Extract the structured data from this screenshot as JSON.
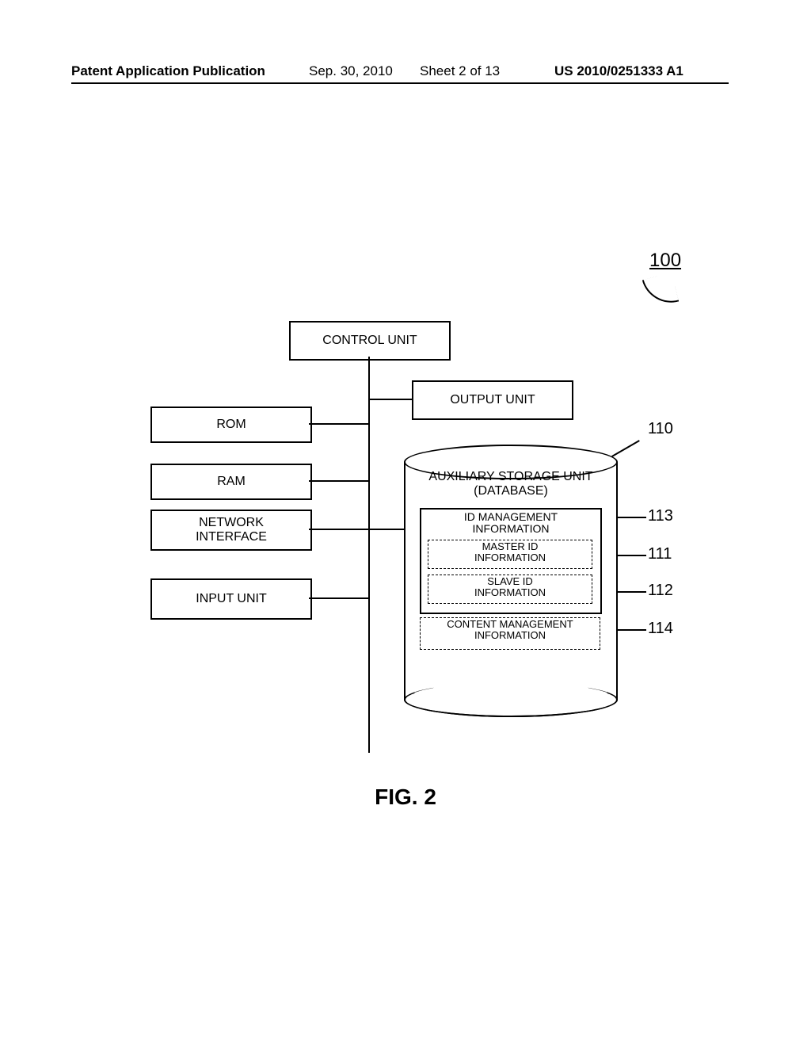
{
  "header": {
    "publication": "Patent Application Publication",
    "date": "Sep. 30, 2010",
    "sheet": "Sheet 2 of 13",
    "patent_no": "US 2010/0251333 A1"
  },
  "refs": {
    "r100": "100",
    "r110": "110",
    "r111": "111",
    "r112": "112",
    "r113": "113",
    "r114": "114"
  },
  "blocks": {
    "control_unit": "CONTROL UNIT",
    "output_unit": "OUTPUT UNIT",
    "rom": "ROM",
    "ram": "RAM",
    "network_if": "NETWORK\nINTERFACE",
    "input_unit": "INPUT UNIT"
  },
  "db": {
    "title": "AUXILIARY STORAGE UNIT\n(DATABASE)",
    "id_mgmt": "ID MANAGEMENT\nINFORMATION",
    "master_id": "MASTER ID\nINFORMATION",
    "slave_id": "SLAVE ID\nINFORMATION",
    "content_mgmt": "CONTENT MANAGEMENT\nINFORMATION"
  },
  "caption": "FIG. 2"
}
